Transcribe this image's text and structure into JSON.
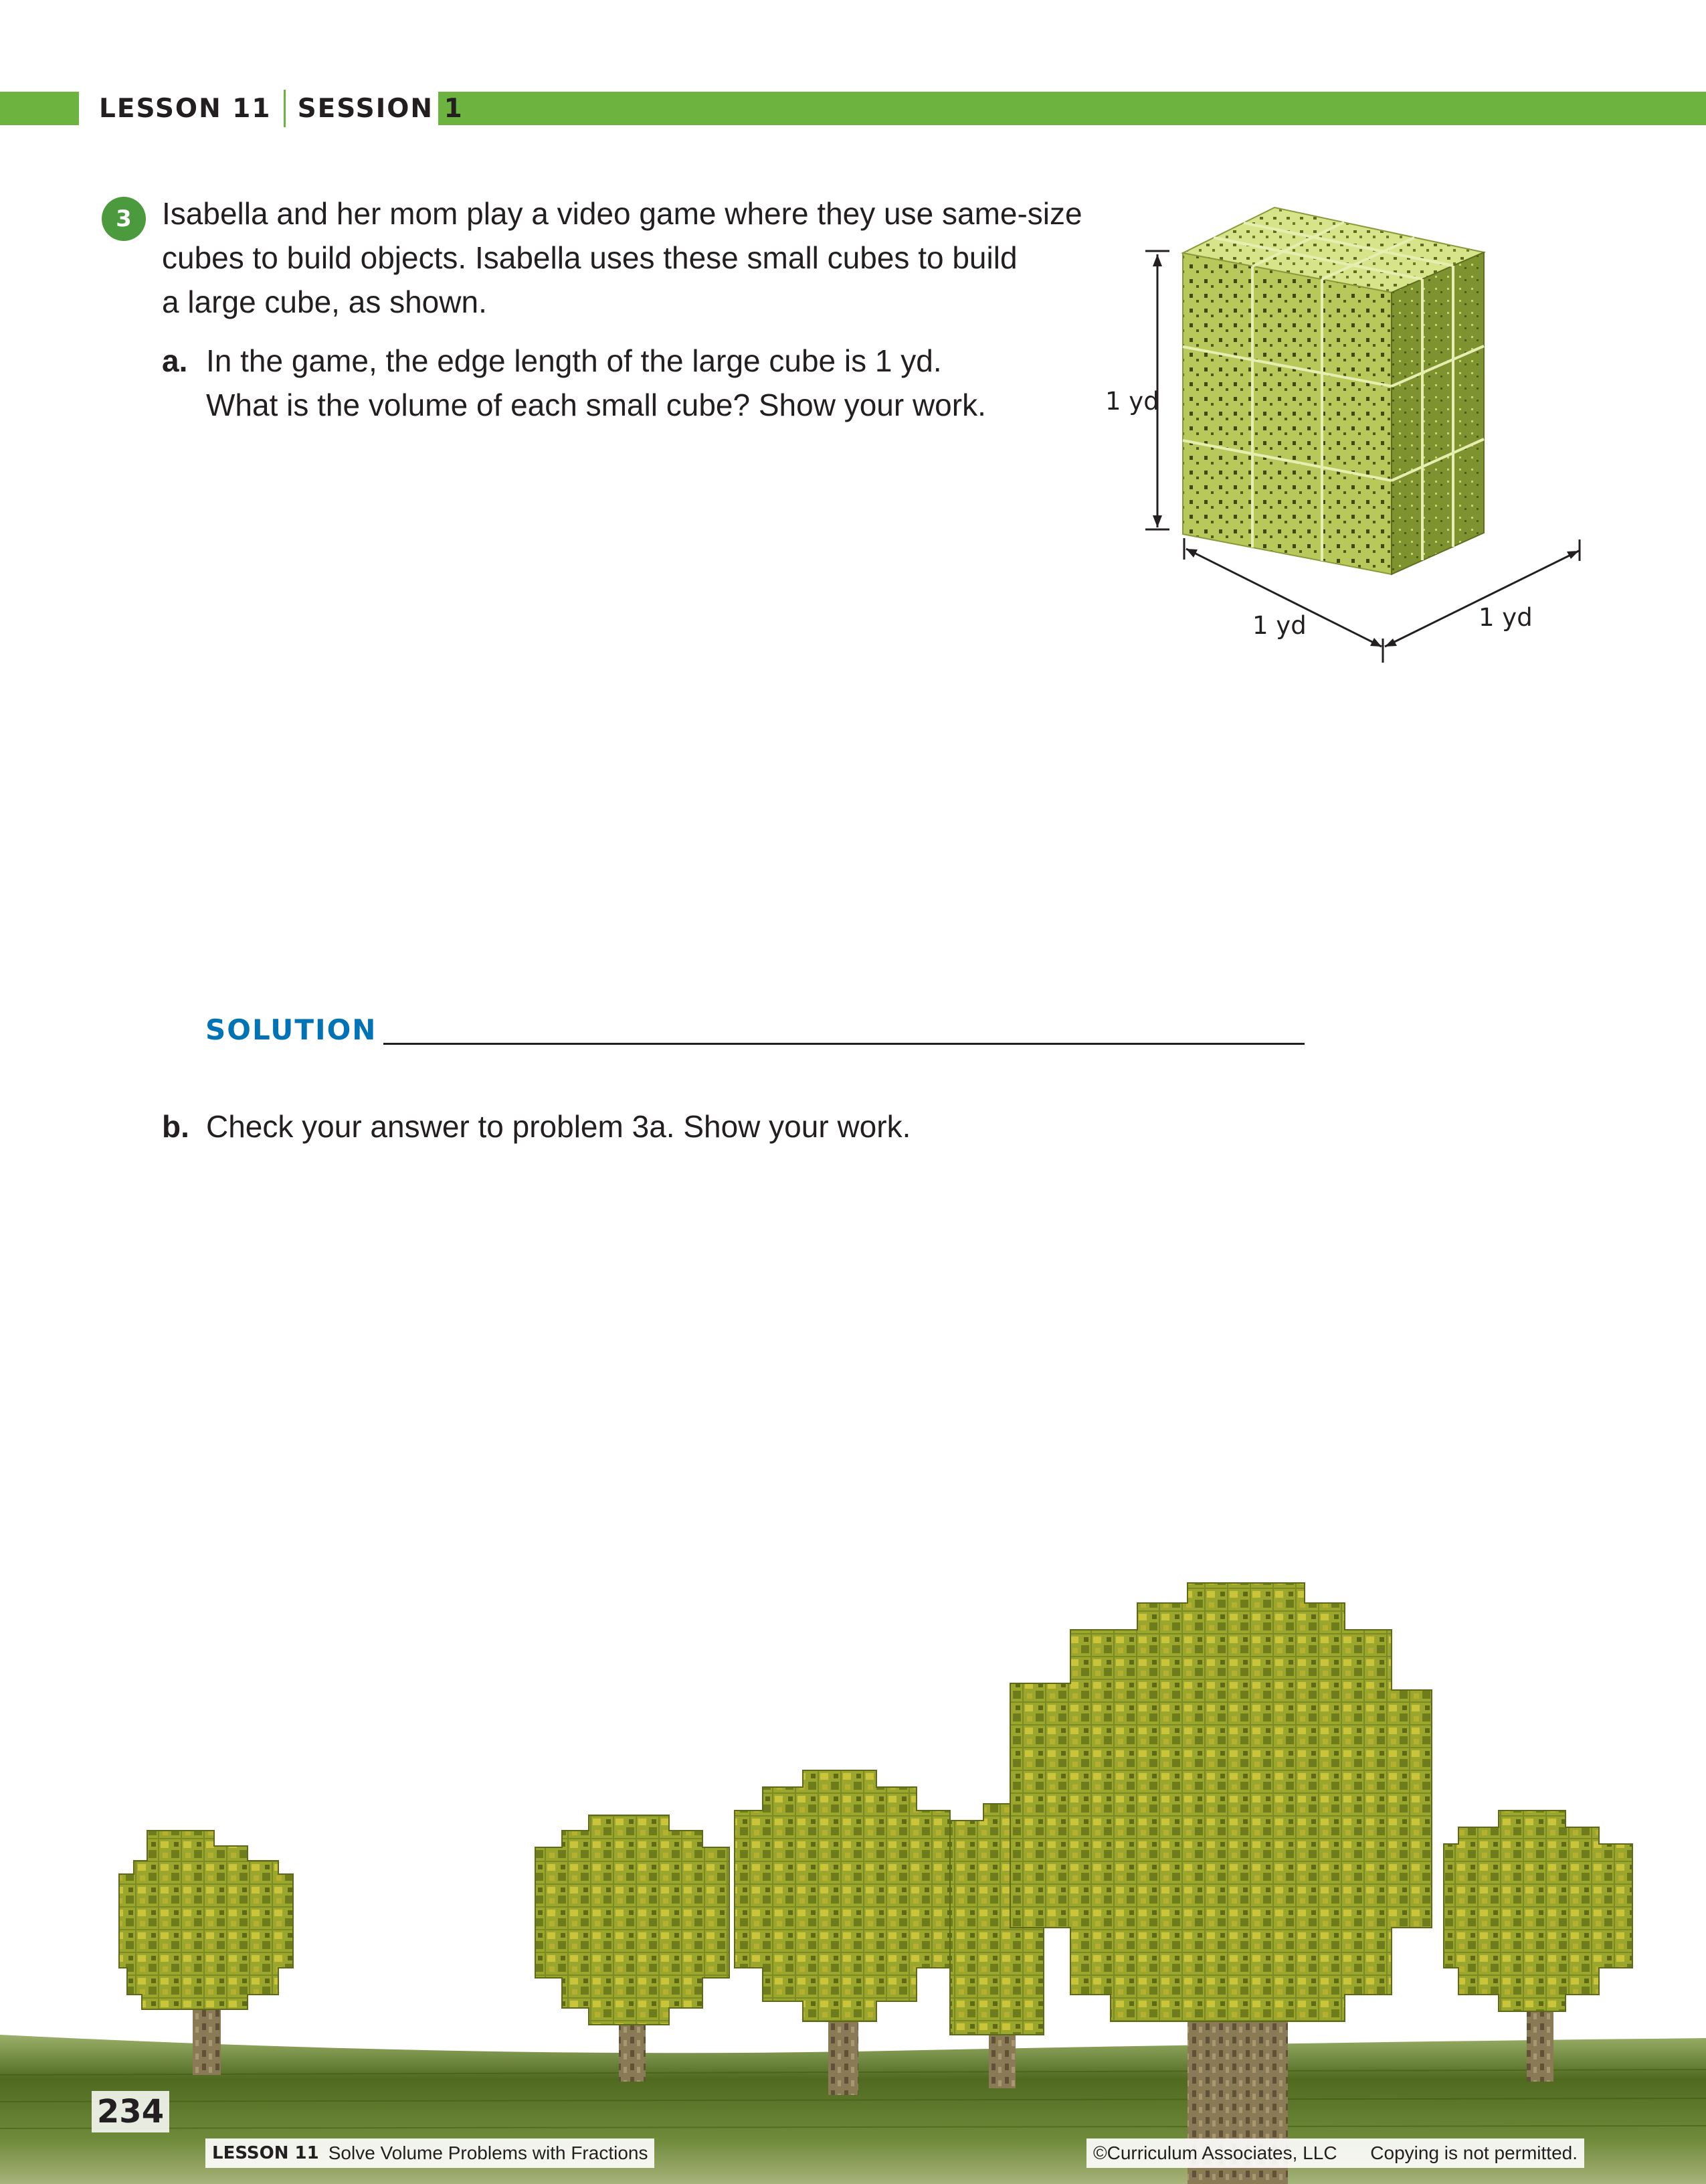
{
  "colors": {
    "accent": "#6cb33f",
    "number_badge": "#4c9a3e",
    "solution": "#0073b6"
  },
  "header": {
    "lesson": "LESSON 11",
    "session": "SESSION 1"
  },
  "problem": {
    "number": "3",
    "stem_lines": [
      "Isabella and her mom play a video game where they use same-size",
      "cubes to build objects. Isabella uses these small cubes to build",
      "a large cube, as shown."
    ],
    "part_a": {
      "label": "a.",
      "lines": [
        "In the game, the edge length of the large cube is 1 yd.",
        "What is the volume of each small cube? Show your work."
      ]
    },
    "solution_label": "SOLUTION",
    "part_b": {
      "label": "b.",
      "text": "Check your answer to problem 3a. Show your work."
    }
  },
  "figure": {
    "description_icon": "cube-3x3x3-icon",
    "height_label": "1 yd",
    "width_label": "1 yd",
    "depth_label": "1 yd"
  },
  "footer": {
    "page_number": "234",
    "lesson": "LESSON 11",
    "lesson_title": "Solve Volume Problems with Fractions",
    "copyright": "©Curriculum Associates, LLC",
    "notice": "Copying is not permitted."
  }
}
